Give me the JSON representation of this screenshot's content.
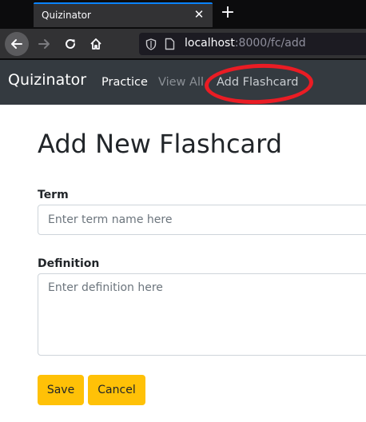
{
  "browser": {
    "tab_title": "Quizinator",
    "tab_close_glyph": "✕",
    "newtab_glyph": "+",
    "url_host": "localhost",
    "url_rest": ":8000/fc/add",
    "icons": [
      "back-arrow-icon",
      "forward-arrow-icon",
      "reload-icon",
      "home-icon",
      "shield-icon",
      "page-icon"
    ]
  },
  "navbar": {
    "brand": "Quizinator",
    "links": [
      {
        "label": "Practice",
        "state": "normal"
      },
      {
        "label": "View All",
        "state": "muted"
      },
      {
        "label": "Add Flashcard",
        "state": "active"
      }
    ],
    "annotation_color": "#ea1c24"
  },
  "form": {
    "title": "Add New Flashcard",
    "term_label": "Term",
    "term_placeholder": "Enter term name here",
    "term_value": "",
    "definition_label": "Definition",
    "definition_placeholder": "Enter definition here",
    "definition_value": "",
    "save_label": "Save",
    "cancel_label": "Cancel",
    "button_color": "#ffc107"
  }
}
